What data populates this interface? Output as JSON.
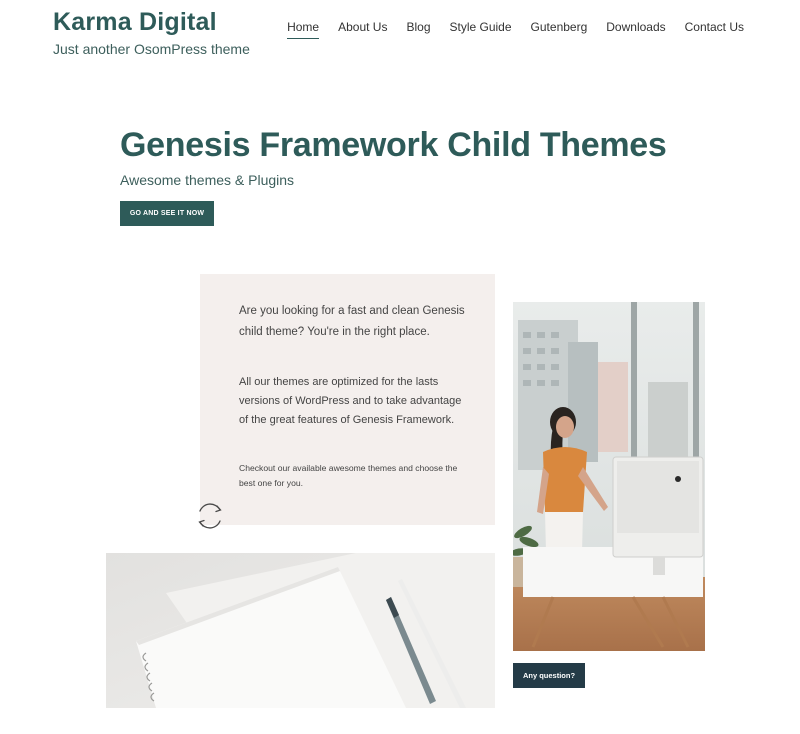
{
  "header": {
    "site_title": "Karma Digital",
    "tagline": "Just another OsomPress theme"
  },
  "nav": {
    "items": [
      {
        "label": "Home",
        "active": true
      },
      {
        "label": "About Us",
        "active": false
      },
      {
        "label": "Blog",
        "active": false
      },
      {
        "label": "Style Guide",
        "active": false
      },
      {
        "label": "Gutenberg",
        "active": false
      },
      {
        "label": "Downloads",
        "active": false
      },
      {
        "label": "Contact Us",
        "active": false
      }
    ]
  },
  "hero": {
    "title": "Genesis Framework Child Themes",
    "subtitle": "Awesome themes & Plugins",
    "button_label": "GO AND SEE IT NOW"
  },
  "intro": {
    "paragraph_1": "Are you looking for a fast and clean Genesis child theme? You're in the right place.",
    "paragraph_2": "All our themes are optimized for the lasts versions of WordPress and to take advantage of the great features of Genesis Framework.",
    "paragraph_3": "Checkout our available awesome themes and choose the best one for you."
  },
  "images": {
    "notebook": "notebook-and-pen-photo",
    "office": "woman-at-desk-photo"
  },
  "cta": {
    "question_label": "Any question?"
  },
  "colors": {
    "accent": "#2e5b59",
    "dark_button": "#243b47",
    "card_bg": "#f4efed"
  },
  "icons": {
    "sync": "sync-icon"
  }
}
